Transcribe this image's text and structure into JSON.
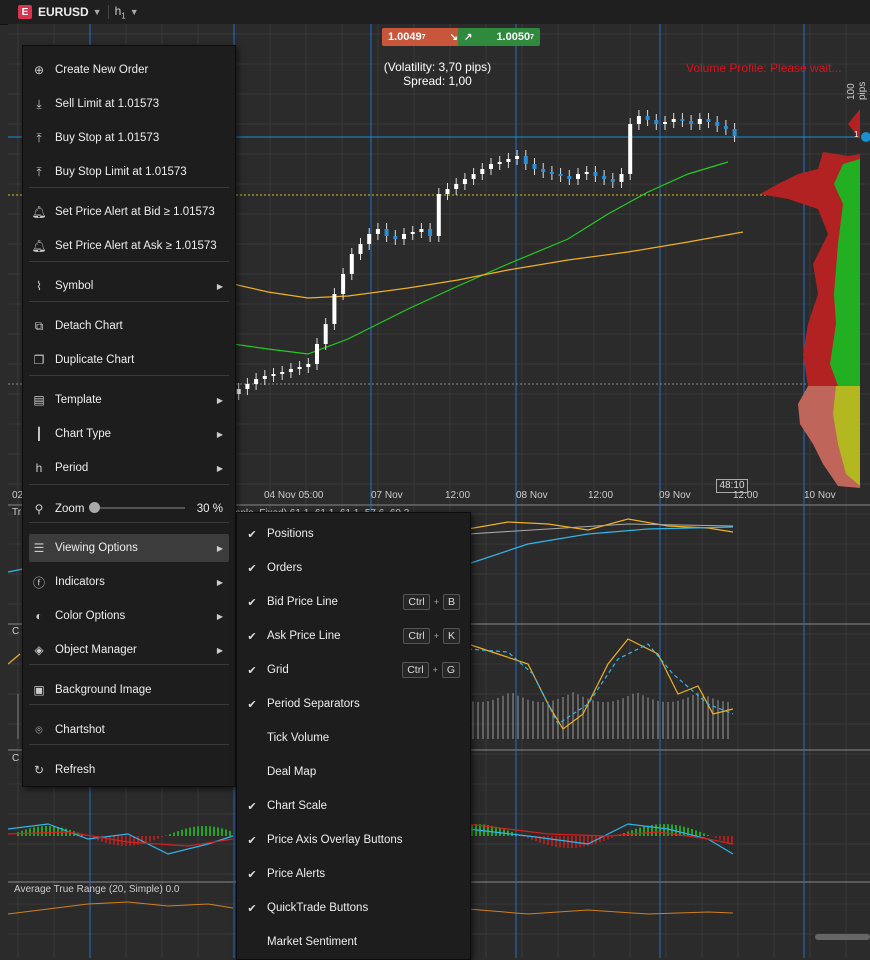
{
  "toolbar": {
    "badge": "E",
    "symbol": "EURUSD",
    "timeframe": "h",
    "timeframe_sub": "1"
  },
  "quotes": {
    "bid": "1.0049",
    "bid_sub": "7",
    "ask": "1.0050",
    "ask_sub": "7"
  },
  "overlay": {
    "volatility": "(Volatility: 3,70 pips)",
    "spread": "Spread: 1,00",
    "volume_profile": "Volume Profile: Please wait...",
    "pips": "100 pips",
    "timer": "48:10",
    "price_marker": "1"
  },
  "x_axis": [
    "02",
    "04 Nov 05:00",
    "07 Nov",
    "12:00",
    "08 Nov",
    "12:00",
    "09 Nov",
    "12:00",
    "10 Nov"
  ],
  "panes": {
    "atr": "Average True Range (20, Simple) 0.0",
    "pane2_label": "C",
    "pane3_label": "C",
    "pane1_label": "Tr",
    "pane1_values": "mple, Fixed) 61.1, 61.1, 61.1, 57.6, 60.3"
  },
  "menu": {
    "items": [
      {
        "label": "Create New Order",
        "icon": "new-order-icon"
      },
      {
        "label": "Sell Limit at 1.01573",
        "icon": "sell-limit-icon"
      },
      {
        "label": "Buy Stop at 1.01573",
        "icon": "buy-stop-icon"
      },
      {
        "label": "Buy Stop Limit at 1.01573",
        "icon": "buy-stop-limit-icon"
      },
      {
        "label": "Set Price Alert at Bid ≥ 1.01573",
        "icon": "bell-icon"
      },
      {
        "label": "Set Price Alert at Ask ≥ 1.01573",
        "icon": "bell-icon"
      },
      {
        "label": "Symbol",
        "icon": "symbol-icon"
      },
      {
        "label": "Detach Chart",
        "icon": "detach-icon"
      },
      {
        "label": "Duplicate Chart",
        "icon": "duplicate-icon"
      },
      {
        "label": "Template",
        "icon": "template-icon"
      },
      {
        "label": "Chart Type",
        "icon": "candles-icon"
      },
      {
        "label": "Period",
        "icon": "period-icon"
      },
      {
        "label": "Zoom",
        "icon": "zoom-icon",
        "value": "30 %"
      },
      {
        "label": "Viewing Options",
        "icon": "viewing-options-icon"
      },
      {
        "label": "Indicators",
        "icon": "indicators-icon"
      },
      {
        "label": "Color Options",
        "icon": "palette-icon"
      },
      {
        "label": "Object Manager",
        "icon": "layers-icon"
      },
      {
        "label": "Background Image",
        "icon": "image-icon"
      },
      {
        "label": "Chartshot",
        "icon": "camera-icon"
      },
      {
        "label": "Refresh",
        "icon": "refresh-icon"
      }
    ]
  },
  "viewing_options": [
    {
      "label": "Positions",
      "checked": true
    },
    {
      "label": "Orders",
      "checked": true
    },
    {
      "label": "Bid Price Line",
      "checked": true,
      "keys": [
        "Ctrl",
        "B"
      ]
    },
    {
      "label": "Ask Price Line",
      "checked": true,
      "keys": [
        "Ctrl",
        "K"
      ]
    },
    {
      "label": "Grid",
      "checked": true,
      "keys": [
        "Ctrl",
        "G"
      ]
    },
    {
      "label": "Period Separators",
      "checked": true
    },
    {
      "label": "Tick Volume",
      "checked": false
    },
    {
      "label": "Deal Map",
      "checked": false
    },
    {
      "label": "Chart Scale",
      "checked": true
    },
    {
      "label": "Price Axis Overlay Buttons",
      "checked": true
    },
    {
      "label": "Price Alerts",
      "checked": true
    },
    {
      "label": "QuickTrade Buttons",
      "checked": true
    },
    {
      "label": "Market Sentiment",
      "checked": false
    }
  ],
  "colors": {
    "bid_bg": "#c8563b",
    "ask_bg": "#2f8a3e",
    "period_sep": "#1f6fd1",
    "ma_green": "#22cc22",
    "ma_orange": "#f0b020",
    "profile_red": "#b22222",
    "profile_green": "#22b022"
  }
}
